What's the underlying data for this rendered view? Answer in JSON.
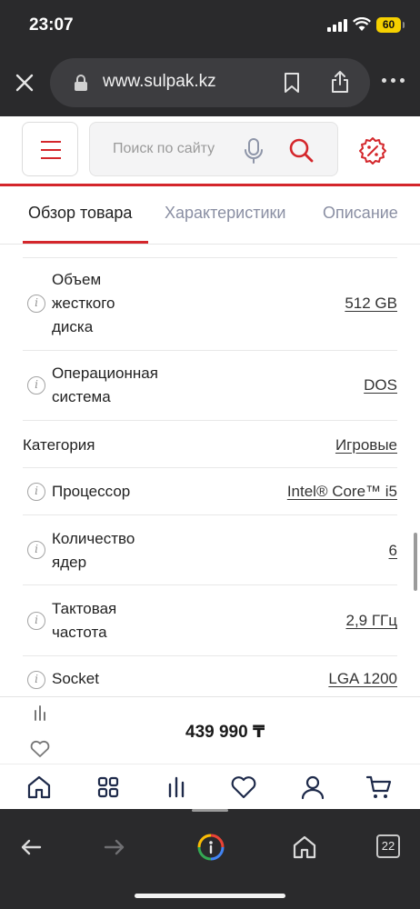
{
  "status_bar": {
    "time": "23:07",
    "battery": "60"
  },
  "browser": {
    "url": "www.sulpak.kz",
    "tab_count": "22"
  },
  "header": {
    "search_placeholder": "Поиск по сайту"
  },
  "colors": {
    "brand_red": "#d4262b",
    "chrome_dark": "#2a2a2c"
  },
  "tabs": [
    {
      "label": "Обзор товара",
      "active": true
    },
    {
      "label": "Характеристики",
      "active": false
    },
    {
      "label": "Описание",
      "active": false
    }
  ],
  "specs": [
    {
      "label": "Объем жесткого диска",
      "value": "512 GB",
      "info": true
    },
    {
      "label": "Операционная система",
      "value": "DOS",
      "info": true
    },
    {
      "label": "Категория",
      "value": "Игровые",
      "info": false
    },
    {
      "label": "Процессор",
      "value": "Intel® Core™ i5",
      "info": true
    },
    {
      "label": "Количество ядер",
      "value": "6",
      "info": true
    },
    {
      "label": "Тактовая частота",
      "value": "2,9 ГГц",
      "info": true
    },
    {
      "label": "Socket",
      "value": "LGA 1200",
      "info": true
    }
  ],
  "price": "439 990 ₸",
  "icons": {
    "bottom_nav": [
      "home-icon",
      "catalog-grid-icon",
      "compare-icon",
      "heart-icon",
      "profile-icon",
      "cart-icon"
    ],
    "toolbar": [
      "back-arrow-icon",
      "forward-arrow-icon",
      "google-lens-icon",
      "home-icon",
      "tabs-icon"
    ]
  }
}
